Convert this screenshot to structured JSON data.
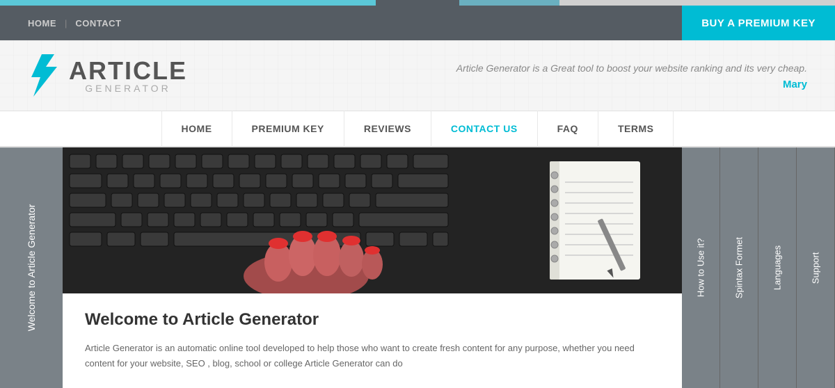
{
  "progress": {
    "segments": [
      "segment1",
      "segment2",
      "segment3"
    ]
  },
  "topnav": {
    "home_label": "HOME",
    "divider": "|",
    "contact_label": "CONTACT",
    "buy_btn_label": "BUY A PREMIUM KEY"
  },
  "header": {
    "logo_article": "ARTICLE",
    "logo_generator": "GENERATOR",
    "tagline": "Article Generator is a Great tool to boost your website ranking and its very cheap.",
    "username": "Mary"
  },
  "mainnav": {
    "items": [
      {
        "label": "HOME",
        "id": "home",
        "active": false
      },
      {
        "label": "PREMIUM KEY",
        "id": "premium-key",
        "active": false
      },
      {
        "label": "REVIEWS",
        "id": "reviews",
        "active": false
      },
      {
        "label": "CONTACT US",
        "id": "contact-us",
        "active": true
      },
      {
        "label": "FAQ",
        "id": "faq",
        "active": false
      },
      {
        "label": "TERMS",
        "id": "terms",
        "active": false
      }
    ]
  },
  "left_label": "Welcome to Article Generator",
  "right_tabs": [
    {
      "label": "Support",
      "id": "support-tab"
    },
    {
      "label": "Languages",
      "id": "languages-tab"
    },
    {
      "label": "Spintax Formet",
      "id": "spintax-tab"
    },
    {
      "label": "How to Use it?",
      "id": "how-to-use-tab"
    }
  ],
  "article": {
    "title": "Welcome to Article Generator",
    "body": "Article Generator is an automatic online tool developed to help those who want to create fresh content for any purpose, whether you need content for your website, SEO , blog, school or college Article Generator can do"
  }
}
